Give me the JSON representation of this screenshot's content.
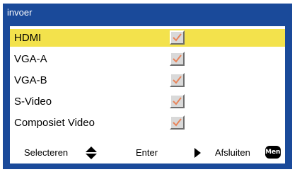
{
  "window": {
    "title": "invoer"
  },
  "inputs": [
    {
      "label": "HDMI",
      "checked": true,
      "selected": true
    },
    {
      "label": "VGA-A",
      "checked": true,
      "selected": false
    },
    {
      "label": "VGA-B",
      "checked": true,
      "selected": false
    },
    {
      "label": "S-Video",
      "checked": true,
      "selected": false
    },
    {
      "label": "Composiet Video",
      "checked": true,
      "selected": false
    }
  ],
  "footer": {
    "select_label": "Selecteren",
    "select_icon": "up-down-arrows-icon",
    "enter_label": "Enter",
    "enter_icon": "right-triangle-icon",
    "exit_label": "Afsluiten",
    "menu_key_label": "Menu"
  },
  "colors": {
    "frame": "#1a4a9a",
    "highlight": "#f3e24c",
    "check": "#e8845a"
  }
}
